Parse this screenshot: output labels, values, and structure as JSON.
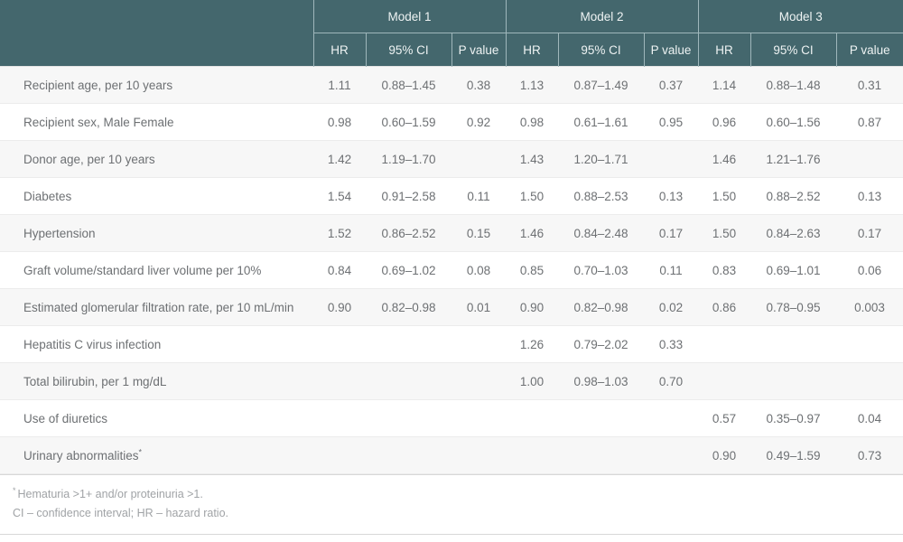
{
  "table": {
    "row_label_header": "",
    "model_groups": [
      {
        "label": "Model 1"
      },
      {
        "label": "Model 2"
      },
      {
        "label": "Model 3"
      }
    ],
    "sub_headers": [
      "HR",
      "95% CI",
      "P value"
    ],
    "rows": [
      {
        "label": "Recipient age, per 10 years",
        "has_superscript": false,
        "cells": [
          "1.11",
          "0.88–1.45",
          "0.38",
          "1.13",
          "0.87–1.49",
          "0.37",
          "1.14",
          "0.88–1.48",
          "0.31"
        ]
      },
      {
        "label": "Recipient sex, Male Female",
        "has_superscript": false,
        "cells": [
          "0.98",
          "0.60–1.59",
          "0.92",
          "0.98",
          "0.61–1.61",
          "0.95",
          "0.96",
          "0.60–1.56",
          "0.87"
        ]
      },
      {
        "label": "Donor age, per 10 years",
        "has_superscript": false,
        "cells": [
          "1.42",
          "1.19–1.70",
          "",
          "1.43",
          "1.20–1.71",
          "",
          "1.46",
          "1.21–1.76",
          ""
        ]
      },
      {
        "label": "Diabetes",
        "has_superscript": false,
        "cells": [
          "1.54",
          "0.91–2.58",
          "0.11",
          "1.50",
          "0.88–2.53",
          "0.13",
          "1.50",
          "0.88–2.52",
          "0.13"
        ]
      },
      {
        "label": "Hypertension",
        "has_superscript": false,
        "cells": [
          "1.52",
          "0.86–2.52",
          "0.15",
          "1.46",
          "0.84–2.48",
          "0.17",
          "1.50",
          "0.84–2.63",
          "0.17"
        ]
      },
      {
        "label": "Graft volume/standard liver volume per 10%",
        "has_superscript": false,
        "cells": [
          "0.84",
          "0.69–1.02",
          "0.08",
          "0.85",
          "0.70–1.03",
          "0.11",
          "0.83",
          "0.69–1.01",
          "0.06"
        ]
      },
      {
        "label": "Estimated glomerular filtration rate, per 10 mL/min",
        "has_superscript": false,
        "cells": [
          "0.90",
          "0.82–0.98",
          "0.01",
          "0.90",
          "0.82–0.98",
          "0.02",
          "0.86",
          "0.78–0.95",
          "0.003"
        ]
      },
      {
        "label": "Hepatitis C virus infection",
        "has_superscript": false,
        "cells": [
          "",
          "",
          "",
          "1.26",
          "0.79–2.02",
          "0.33",
          "",
          "",
          ""
        ]
      },
      {
        "label": "Total bilirubin, per 1 mg/dL",
        "has_superscript": false,
        "cells": [
          "",
          "",
          "",
          "1.00",
          "0.98–1.03",
          "0.70",
          "",
          "",
          ""
        ]
      },
      {
        "label": "Use of diuretics",
        "has_superscript": false,
        "cells": [
          "",
          "",
          "",
          "",
          "",
          "",
          "0.57",
          "0.35–0.97",
          "0.04"
        ]
      },
      {
        "label": "Urinary abnormalities",
        "has_superscript": true,
        "superscript": "*",
        "cells": [
          "",
          "",
          "",
          "",
          "",
          "",
          "0.90",
          "0.49–1.59",
          "0.73"
        ]
      }
    ]
  },
  "footnotes": {
    "marker": "*",
    "note1": "Hematuria >1+ and/or proteinuria >1.",
    "note2": "CI – confidence interval; HR – hazard ratio."
  },
  "colors": {
    "header_background": "#44676d",
    "header_text": "#eef3f3",
    "header_divider": "#9fb7bb",
    "row_stripe": "#f7f7f7",
    "row_plain": "#ffffff",
    "body_text": "#6d7073",
    "footnote_text": "#a0a3a6",
    "row_border": "#ececec"
  }
}
